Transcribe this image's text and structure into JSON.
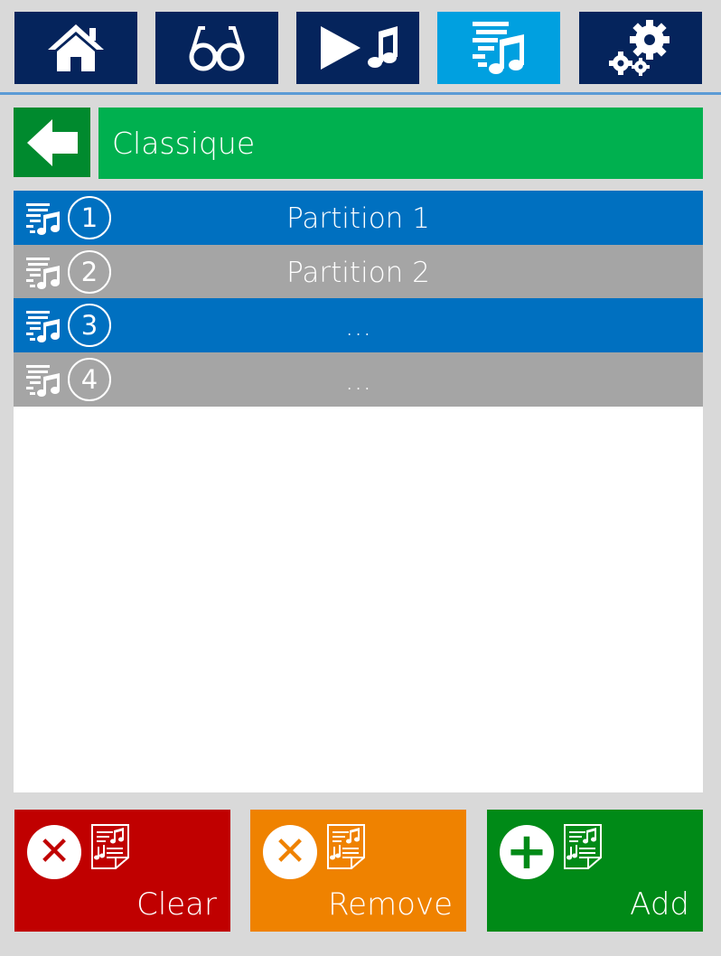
{
  "nav": {
    "items": [
      {
        "name": "home-icon",
        "active": false
      },
      {
        "name": "glasses-icon",
        "active": false
      },
      {
        "name": "play-music-icon",
        "active": false
      },
      {
        "name": "music-list-icon",
        "active": true
      },
      {
        "name": "settings-gears-icon",
        "active": false
      }
    ]
  },
  "header": {
    "back_icon": "back-arrow-icon",
    "title": "Classique"
  },
  "list": {
    "rows": [
      {
        "number": "1",
        "label": "Partition 1",
        "color": "#0070c0"
      },
      {
        "number": "2",
        "label": "Partition 2",
        "color": "#a5a5a5"
      },
      {
        "number": "3",
        "label": "...",
        "color": "#0070c0"
      },
      {
        "number": "4",
        "label": "...",
        "color": "#a5a5a5"
      }
    ]
  },
  "actions": {
    "clear": {
      "label": "Clear",
      "color": "#c00000",
      "symbol": "✕"
    },
    "remove": {
      "label": "Remove",
      "color": "#ef8200",
      "symbol": "✕"
    },
    "add": {
      "label": "Add",
      "color": "#008a17",
      "symbol": "+"
    }
  },
  "colors": {
    "nav_bg": "#05245c",
    "nav_active": "#00a0e0",
    "title_bg": "#00b04f",
    "back_bg": "#008a2e"
  }
}
